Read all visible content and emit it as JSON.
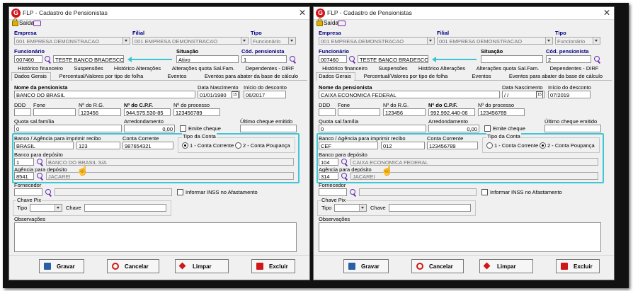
{
  "window_title": "FLP - Cadastro de Pensionistas",
  "menu": {
    "exit_label": "Saída"
  },
  "labels": {
    "empresa": "Empresa",
    "filial": "Filial",
    "tipo": "Tipo",
    "funcionario": "Funcionário",
    "situacao": "Situação",
    "cod_pensionista": "Cód. pensionista",
    "nome_pensionista": "Nome da pensionista",
    "data_nascimento": "Data Nascimento",
    "inicio_desconto": "Início do desconto",
    "ddd": "DDD",
    "fone": "Fone",
    "num_rg": "Nº do R.G.",
    "num_cpf": "Nº do C.P.F.",
    "num_processo": "Nº do processo",
    "quota_salfamilia": "Quota sal.família",
    "arredondamento": "Arredondamento",
    "emite_cheque": "Emite cheque",
    "ultimo_cheque": "Último cheque emitido",
    "banco_agencia": "Banco / Agência para imprimir recibo",
    "conta_corrente": "Conta Corrente",
    "tipo_conta": "Tipo da Conta",
    "radio_corrente": "1 - Conta Corrente",
    "radio_poupanca": "2 - Conta Poupança",
    "banco_deposito": "Banco para depósito",
    "agencia_deposito": "Agência para depósito",
    "fornecedor": "Fornecedor",
    "informar_inss": "Informar INSS no Afastamento",
    "chave_pix": "Chave Pix",
    "pix_tipo": "Tipo",
    "pix_chave": "Chave",
    "observacoes": "Observações"
  },
  "tabs_row1": [
    "Histórico financeiro",
    "Suspensões",
    "Histórico Alterações",
    "Alterações quota Sal.Fam.",
    "Dependentes - DIRF"
  ],
  "tabs_row2": [
    "Dados Gerais",
    "Percentual/Valores por tipo de folha",
    "Eventos",
    "Eventos para abater da base de cálculo"
  ],
  "buttons": {
    "gravar": "Gravar",
    "cancelar": "Cancelar",
    "limpar": "Limpar",
    "excluir": "Excluir"
  },
  "accent_color": "#3fc7d6",
  "forms": [
    {
      "empresa": "001 EMPRESA DEMONSTRACAO",
      "filial": "001 EMPRESA DEMONSTRACAO",
      "tipo": "Funcionário",
      "funcionario_cod": "007460",
      "funcionario_nome": "TESTE BANCO BRADESCO",
      "situacao": "Ativo",
      "cod_pensionista": "1",
      "nome_pensionista": "BANCO DO BRASIL",
      "data_nascimento": "01/01/1980",
      "inicio_desconto": "06/2017",
      "ddd": "",
      "fone": "",
      "rg": "123456",
      "cpf": "944.575.530-85",
      "processo": "123456789",
      "quota": "0",
      "arredondamento": "0,00",
      "ultimo_cheque": "",
      "banco_recibo": "BRASIL",
      "agencia_recibo": "123",
      "conta_corrente": "987654321",
      "tipo_conta_selected": "1",
      "banco_deposito_cod": "1_",
      "banco_deposito_nome": "BANCO DO BRASIL S/A",
      "agencia_deposito_cod": "8541_",
      "agencia_deposito_nome": "JACAREI",
      "fornecedor_cod": "",
      "fornecedor_nome": "",
      "pix_tipo": "",
      "pix_chave": "",
      "observacoes": ""
    },
    {
      "empresa": "001 EMPRESA DEMONSTRACAO",
      "filial": "001 EMPRESA DEMONSTRACAO",
      "tipo": "Funcionário",
      "funcionario_cod": "007460",
      "funcionario_nome": "TESTE BANCO BRADESCO",
      "situacao": "",
      "cod_pensionista": "2",
      "nome_pensionista": "CAIXA ECONOMICA FEDERAL",
      "data_nascimento": " / /",
      "inicio_desconto": "07/2019",
      "ddd": "",
      "fone": "",
      "rg": "123456",
      "cpf": "992.992.440-06",
      "processo": "123456789",
      "quota": "0",
      "arredondamento": "0,00",
      "ultimo_cheque": "",
      "banco_recibo": "CEF",
      "agencia_recibo": "012",
      "conta_corrente": "123456789",
      "tipo_conta_selected": "2",
      "banco_deposito_cod": "104",
      "banco_deposito_nome": "CAIXA ECONOMICA FEDERAL",
      "agencia_deposito_cod": "314_",
      "agencia_deposito_nome": "JACAREI",
      "fornecedor_cod": "",
      "fornecedor_nome": "",
      "pix_tipo": "",
      "pix_chave": "",
      "observacoes": ""
    }
  ]
}
